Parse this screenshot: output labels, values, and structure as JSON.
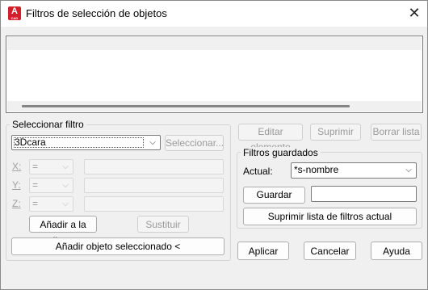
{
  "window": {
    "title": "Filtros de selección de objetos",
    "app_icon_letter": "A",
    "app_icon_sub": "CAD"
  },
  "select_filter": {
    "legend": "Seleccionar filtro",
    "filter_value": "3Dcara",
    "select_button": "Seleccionar...",
    "x_label": "X:",
    "y_label": "Y:",
    "z_label": "Z:",
    "x_operator": "=",
    "y_operator": "=",
    "z_operator": "=",
    "add_to_list_button": "Añadir a la lista:",
    "replace_button": "Sustituir",
    "add_selected_button": "Añadir objeto seleccionado <"
  },
  "list_actions": {
    "edit_button": "Editar elemento",
    "delete_button": "Suprimir",
    "clear_button": "Borrar lista"
  },
  "saved_filters": {
    "legend": "Filtros guardados",
    "current_label": "Actual:",
    "current_value": "*s-nombre",
    "save_as_button": "Guardar como:",
    "save_as_value": "",
    "delete_list_button": "Suprimir lista de filtros actual"
  },
  "footer": {
    "apply_button": "Aplicar",
    "cancel_button": "Cancelar",
    "help_button": "Ayuda"
  }
}
